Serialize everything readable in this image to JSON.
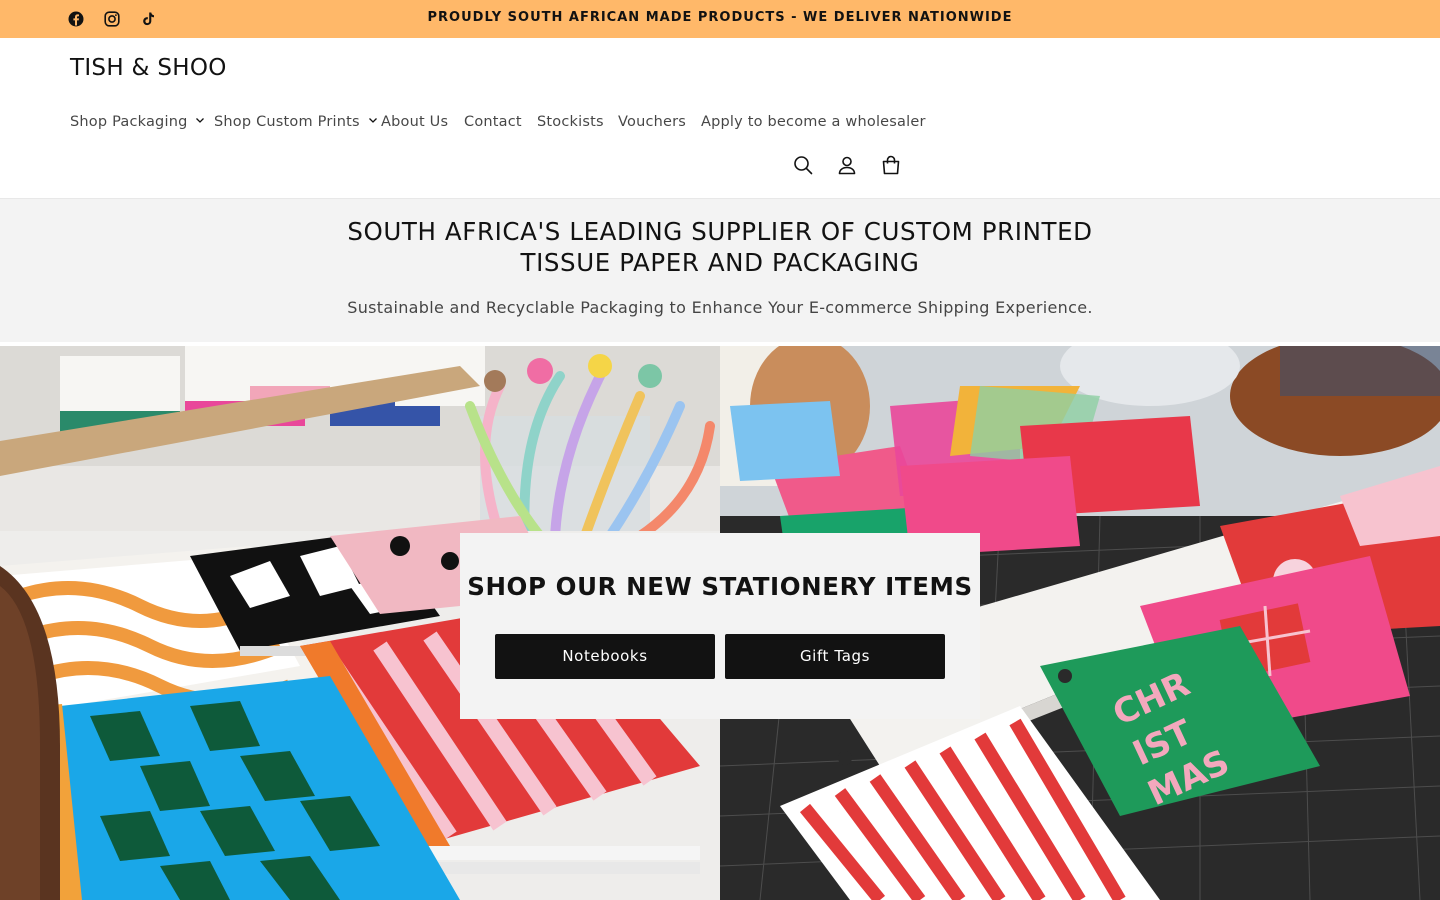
{
  "announcement": {
    "text": "PROUDLY SOUTH AFRICAN MADE PRODUCTS - WE DELIVER NATIONWIDE",
    "background": "#ffb869",
    "social_icons": [
      "facebook-icon",
      "instagram-icon",
      "tiktok-icon"
    ]
  },
  "header": {
    "logo": "TISH & SHOO",
    "nav": [
      {
        "label": "Shop Packaging",
        "has_dropdown": true
      },
      {
        "label": "Shop Custom Prints",
        "has_dropdown": true
      },
      {
        "label": "About Us",
        "has_dropdown": false
      },
      {
        "label": "Contact",
        "has_dropdown": false
      },
      {
        "label": "Stockists",
        "has_dropdown": false
      },
      {
        "label": "Vouchers",
        "has_dropdown": false
      },
      {
        "label": "Apply to become a wholesaler",
        "has_dropdown": false
      }
    ],
    "icons": [
      "search-icon",
      "account-icon",
      "cart-icon"
    ]
  },
  "intro": {
    "title": "SOUTH AFRICA'S LEADING SUPPLIER OF CUSTOM PRINTED TISSUE PAPER AND PACKAGING",
    "subtitle": "Sustainable and Recyclable Packaging to Enhance Your E-commerce Shipping Experience."
  },
  "hero": {
    "left_image": "stationery-notebooks-photo",
    "right_image": "christmas-gift-tags-photo",
    "card_title": "SHOP OUR NEW STATIONERY ITEMS",
    "buttons": [
      "Notebooks",
      "Gift Tags"
    ]
  },
  "colors": {
    "accent": "#ffb869",
    "text": "#121212",
    "band": "#f3f3f3",
    "button": "#121212"
  }
}
